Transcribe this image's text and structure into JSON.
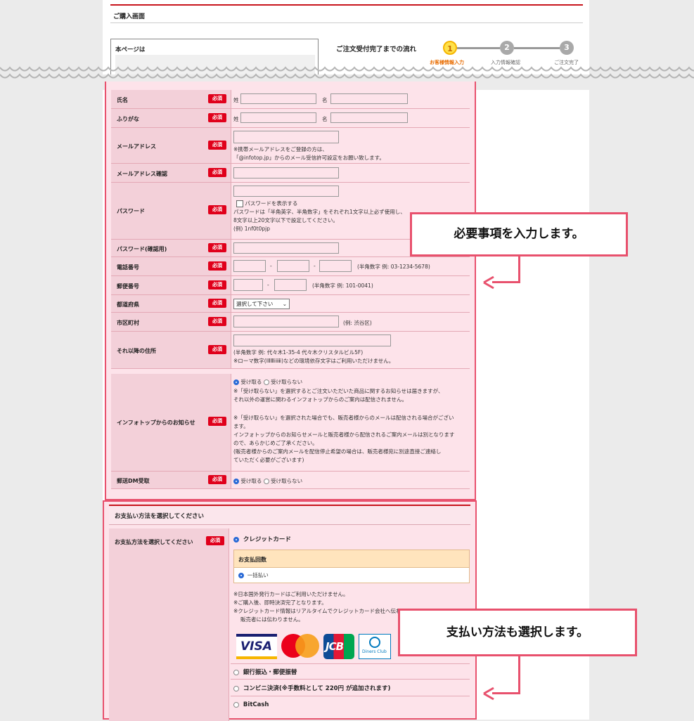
{
  "header": {
    "page_title": "ご購入画面",
    "notice_label": "本ページは",
    "flow_title": "ご注文受付完了までの流れ",
    "steps": [
      {
        "num": "1",
        "label": "お客様情報入力"
      },
      {
        "num": "2",
        "label": "入力情報確認"
      },
      {
        "num": "3",
        "label": "ご注文完了"
      }
    ]
  },
  "required_badge": "必須",
  "form": {
    "name": {
      "label": "氏名",
      "last": "姓",
      "first": "名"
    },
    "kana": {
      "label": "ふりがな",
      "last": "姓",
      "first": "名"
    },
    "email": {
      "label": "メールアドレス",
      "note1": "※携帯メールアドレスをご登録の方は、",
      "note2": "「@infotop.jp」からのメール受信許可設定をお願い致します。"
    },
    "email_confirm": {
      "label": "メールアドレス確認"
    },
    "password": {
      "label": "パスワード",
      "show": "パスワードを表示する",
      "note1": "パスワードは「半角英字、半角数字」をそれぞれ1文字以上必ず使用し、",
      "note2": "8文字以上20文字以下で設定してください。",
      "note3": "(例) 1nf0t0pjp"
    },
    "password_confirm": {
      "label": "パスワード(確認用)"
    },
    "phone": {
      "label": "電話番号",
      "dash": "-",
      "hint": "(半角数字 例: 03-1234-5678)"
    },
    "zip": {
      "label": "郵便番号",
      "dash": "-",
      "hint": "(半角数字 例: 101-0041)"
    },
    "prefecture": {
      "label": "都道府県",
      "selected": "選択して下さい"
    },
    "city": {
      "label": "市区町村",
      "hint": "(例: 渋谷区)"
    },
    "address": {
      "label": "それ以降の住所",
      "hint1": "(半角数字 例: 代々木1-35-4 代々木クリスタルビル5F)",
      "hint2": "※ローマ数字(ⅠⅡⅢⅰⅱⅲ)などの環境依存文字はご利用いただけません。"
    },
    "notice_mail": {
      "label": "インフォトップからのお知らせ",
      "opt_yes": "受け取る",
      "opt_no": "受け取らない",
      "line1": "※「受け取らない」を選択するとご注文いただいた商品に関するお知らせは届きますが、",
      "line2": "それ以外の運営に関わるインフォトップからのご案内は配信されません。",
      "line3": "※「受け取らない」を選択された場合でも、販売者様からのメールは配信される場合がござい",
      "line4": "ます。",
      "line5": "インフォトップからのお知らせメールと販売者様から配信されるご案内メールは別となります",
      "line6": "ので、あらかじめご了承ください。",
      "line7": "(販売者様からのご案内メールを配信停止希望の場合は、販売者様宛に別途直接ご連絡し",
      "line8": "ていただく必要がございます)"
    },
    "dm": {
      "label": "郵送DM受取",
      "opt_yes": "受け取る",
      "opt_no": "受け取らない"
    }
  },
  "payment": {
    "section_title": "お支払い方法を選択してください",
    "label": "お支払方法を選択してください",
    "credit": "クレジットカード",
    "installments_head": "お支払回数",
    "installments_opt": "一括払い",
    "note1": "※日本国外発行カードはご利用いただけません。",
    "note2": "※ご購入後、即時決済完了となります。",
    "note3": "※クレジットカード情報はリアルタイムでクレジットカード会社へ伝わります。",
    "note4": "販売者には伝わりません。",
    "cards": {
      "visa": "VISA",
      "jcb": "JCB",
      "diners": "Diners Club"
    },
    "bank": "銀行振込・郵便振替",
    "convenience": "コンビニ決済(※手数料として 220円 が追加されます)",
    "bitcash": "BitCash"
  },
  "callouts": {
    "top": "必要事項を入力します。",
    "bottom": "支払い方法も選択します。"
  },
  "colors": {
    "accent": "#e8516d",
    "brand_red": "#c8141c",
    "form_bg": "#fde3ea"
  }
}
